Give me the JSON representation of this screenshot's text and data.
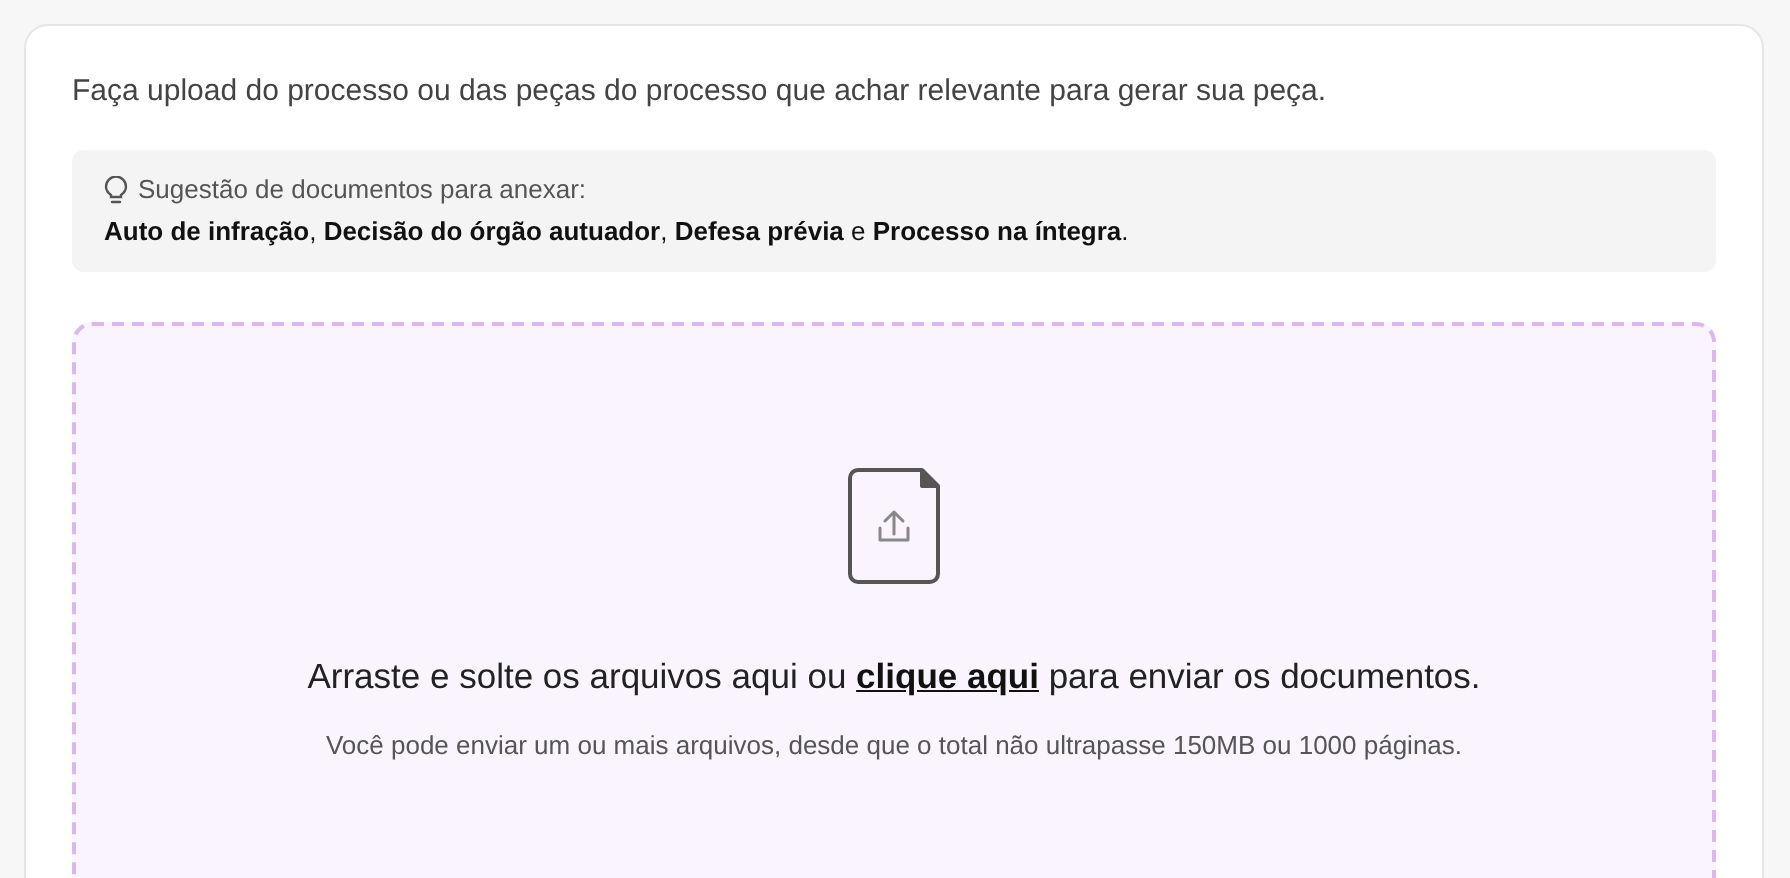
{
  "intro": "Faça upload do processo ou das peças do processo que achar relevante para gerar sua peça.",
  "suggestion": {
    "title": "Sugestão de documentos para anexar:",
    "documents": "**Auto de infração**, **Decisão do órgão autuador**, **Defesa prévia** e **Processo na íntegra**."
  },
  "dropzone": {
    "before": "Arraste e solte os arquivos aqui ou",
    "link": "clique aqui",
    "after": "para enviar os documentos.",
    "note": "Você pode enviar um ou mais arquivos, desde que o total não ultrapasse 150MB ou 1000 páginas."
  }
}
